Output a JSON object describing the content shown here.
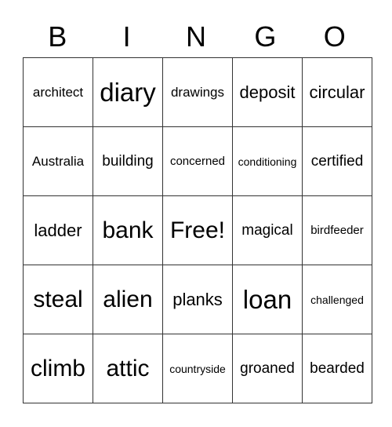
{
  "header": {
    "letters": [
      "B",
      "I",
      "N",
      "G",
      "O"
    ]
  },
  "grid": {
    "rows": [
      [
        "architect",
        "diary",
        "drawings",
        "deposit",
        "circular"
      ],
      [
        "Australia",
        "building",
        "concerned",
        "conditioning",
        "certified"
      ],
      [
        "ladder",
        "bank",
        "Free!",
        "magical",
        "birdfeeder"
      ],
      [
        "steal",
        "alien",
        "planks",
        "loan",
        "challenged"
      ],
      [
        "climb",
        "attic",
        "countryside",
        "groaned",
        "bearded"
      ]
    ]
  }
}
